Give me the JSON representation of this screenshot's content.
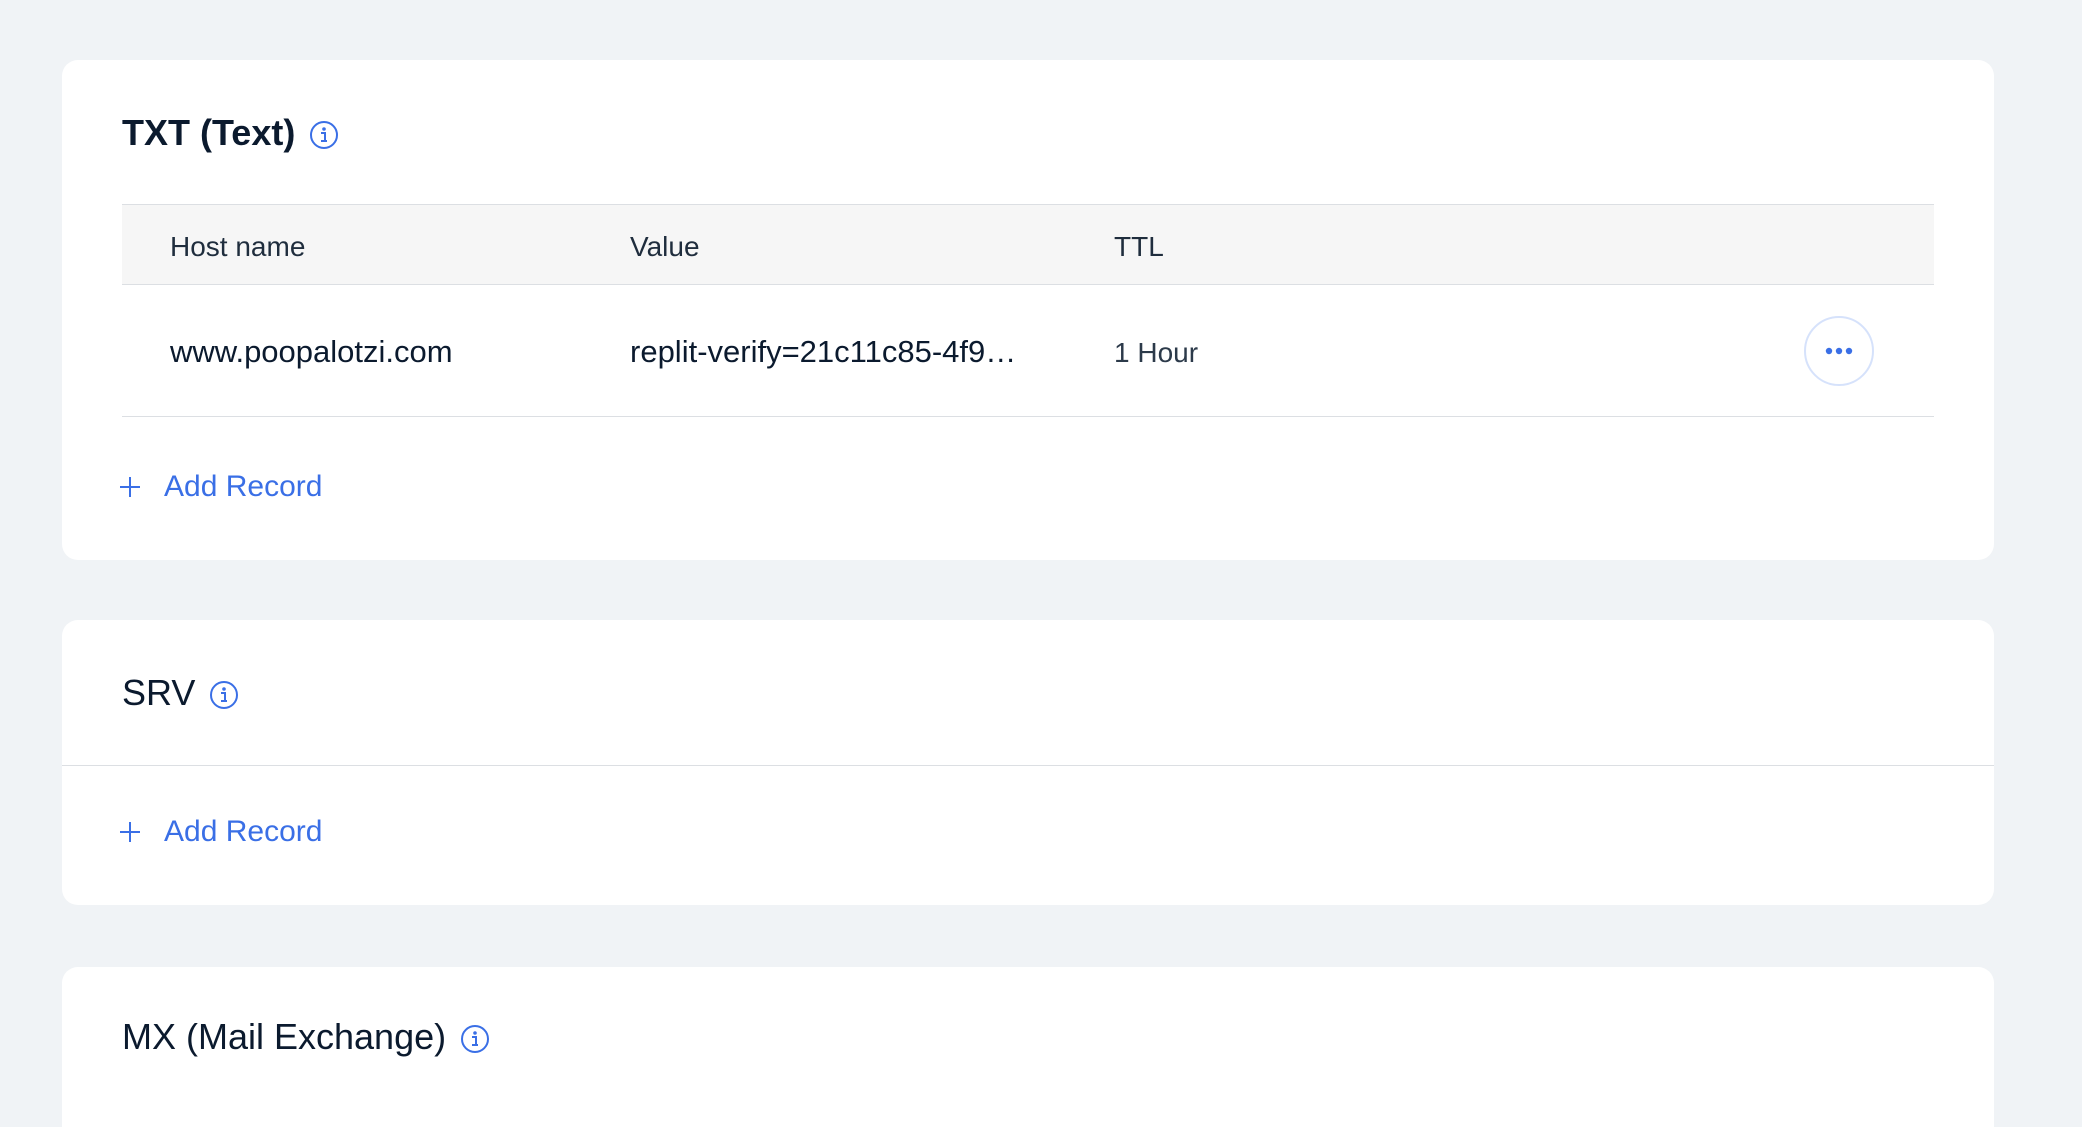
{
  "txt_section": {
    "title": "TXT (Text)",
    "columns": {
      "host": "Host name",
      "value": "Value",
      "ttl": "TTL"
    },
    "rows": [
      {
        "host": "www.poopalotzi.com",
        "value": "replit-verify=21c11c85-4f9…",
        "ttl": "1 Hour"
      }
    ],
    "add_label": "Add Record"
  },
  "srv_section": {
    "title": "SRV",
    "add_label": "Add Record"
  },
  "mx_section": {
    "title": "MX (Mail Exchange)"
  },
  "icons": {
    "info": "info-icon",
    "more": "more-horizontal-icon",
    "plus": "plus-icon"
  },
  "colors": {
    "background": "#f0f3f6",
    "card": "#ffffff",
    "accent": "#3a6fe6",
    "text": "#0b1a2e",
    "header_bg": "#f6f6f6",
    "divider": "#dcdfe3"
  }
}
